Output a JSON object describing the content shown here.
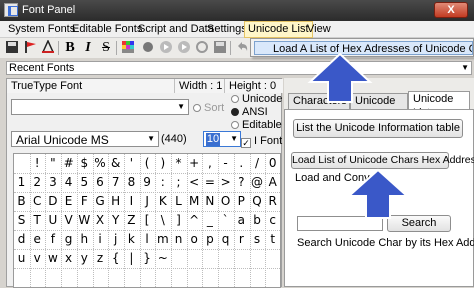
{
  "window": {
    "title": "Font Panel",
    "close_label": "X"
  },
  "menubar": {
    "items": [
      "System Fonts",
      "Editable Fonts",
      "Script and Data",
      "Settings",
      "Unicode List",
      "View"
    ],
    "active_index": 4
  },
  "dropdown": {
    "item": "Load A List of Hex Adresses of Unicode Chars and C"
  },
  "toolbar": {
    "icons": [
      "save-icon",
      "red-flag-icon",
      "text-color-icon",
      "bold-icon",
      "italic-icon",
      "strikethrough-icon",
      "color-grid-icon",
      "record-icon",
      "play-icon",
      "play-icon",
      "refresh-icon",
      "save-disk-icon",
      "separator-icon",
      "undo-icon",
      "redo-icon",
      "globe-icon",
      "pen-icon",
      "table-icon",
      "info-icon",
      "settings-icon"
    ],
    "bold_label": "B",
    "italic_label": "I",
    "strike_label": "S"
  },
  "recent_fonts": {
    "label": "Recent Fonts"
  },
  "font_panel": {
    "header_type": "TrueType Font",
    "header_width": "Width : 1",
    "header_height": "Height : 0",
    "sort_label": "Sort",
    "font_name": "Arial Unicode MS",
    "font_count": "(440)",
    "font_size": "10",
    "radio_unicode": "Unicode",
    "radio_ansi": "ANSI",
    "radio_editable": "Editable",
    "check_label": "I Font",
    "check_mark": "✓"
  },
  "char_grid": {
    "rows": [
      [
        "",
        "!",
        "\"",
        "#",
        "$",
        "%",
        "&",
        "'",
        "(",
        ")",
        "*",
        "+",
        ",",
        "-",
        ".",
        "/",
        "0"
      ],
      [
        "1",
        "2",
        "3",
        "4",
        "5",
        "6",
        "7",
        "8",
        "9",
        ":",
        ";",
        "<",
        "=",
        ">",
        "?",
        "@",
        "A"
      ],
      [
        "B",
        "C",
        "D",
        "E",
        "F",
        "G",
        "H",
        "I",
        "J",
        "K",
        "L",
        "M",
        "N",
        "O",
        "P",
        "Q",
        "R"
      ],
      [
        "S",
        "T",
        "U",
        "V",
        "W",
        "X",
        "Y",
        "Z",
        "[",
        "\\",
        "]",
        "^",
        "_",
        "`",
        "a",
        "b",
        "c"
      ],
      [
        "d",
        "e",
        "f",
        "g",
        "h",
        "i",
        "j",
        "k",
        "l",
        "m",
        "n",
        "o",
        "p",
        "q",
        "r",
        "s",
        "t"
      ],
      [
        "u",
        "v",
        "w",
        "x",
        "y",
        "z",
        "{",
        "|",
        "}",
        "~",
        "",
        "",
        "",
        "",
        "",
        "",
        ""
      ],
      [
        "",
        "",
        "",
        "",
        "",
        "",
        "",
        "",
        "",
        "",
        "",
        "",
        "",
        "",
        "",
        "",
        ""
      ]
    ]
  },
  "right_panel": {
    "tabs": [
      "Characters View",
      "Unicode Info",
      "Unicode List"
    ],
    "active_tab": 2,
    "btn_list_info": "List the Unicode Information table",
    "btn_load_hex": "Load List of Unicode Chars Hex Addresses",
    "load_convert": "Load and Convert",
    "search_button": "Search",
    "search_value": "",
    "search_caption": "Search Unicode Char by its Hex Address"
  },
  "colors": {
    "arrow": "#3a58c8",
    "accent": "#3a6fd0"
  }
}
